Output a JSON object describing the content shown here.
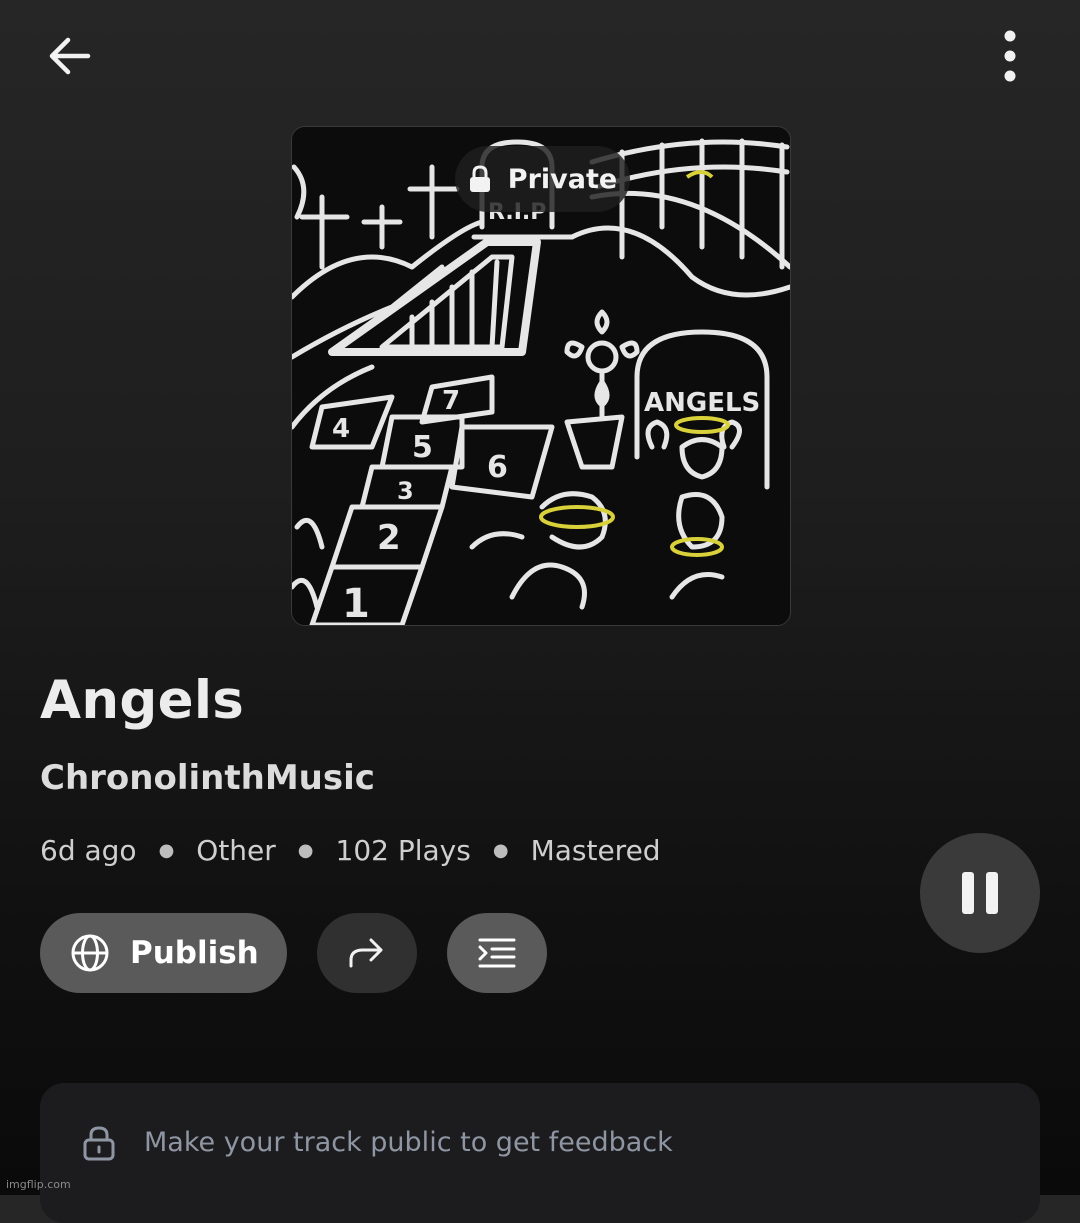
{
  "header": {
    "back_icon": "arrow-left-icon",
    "more_icon": "more-vertical-icon"
  },
  "cover": {
    "badge_label": "Private",
    "badge_icon": "lock-icon",
    "artwork_text": {
      "tombstone": "R.I.P",
      "sign": "ANGELS",
      "hopscotch": [
        "1",
        "2",
        "3",
        "4",
        "5",
        "6",
        "7"
      ]
    }
  },
  "track": {
    "title": "Angels",
    "artist": "ChronolinthMusic",
    "meta": {
      "age": "6d ago",
      "genre": "Other",
      "plays": "102 Plays",
      "status": "Mastered"
    }
  },
  "actions": {
    "publish_label": "Publish",
    "publish_icon": "globe-icon",
    "share_icon": "share-forward-icon",
    "lyrics_icon": "lyrics-lines-icon",
    "pause_icon": "pause-icon"
  },
  "feedback": {
    "icon": "lock-icon",
    "text": "Make your track public to get feedback"
  },
  "watermark": "imgflip.com",
  "colors": {
    "background": "#1e1e1e",
    "button_gray": "#5a5a5a",
    "button_dark": "#303030",
    "feedback_text": "#8f96a3",
    "halo_yellow": "#d9d13a"
  }
}
